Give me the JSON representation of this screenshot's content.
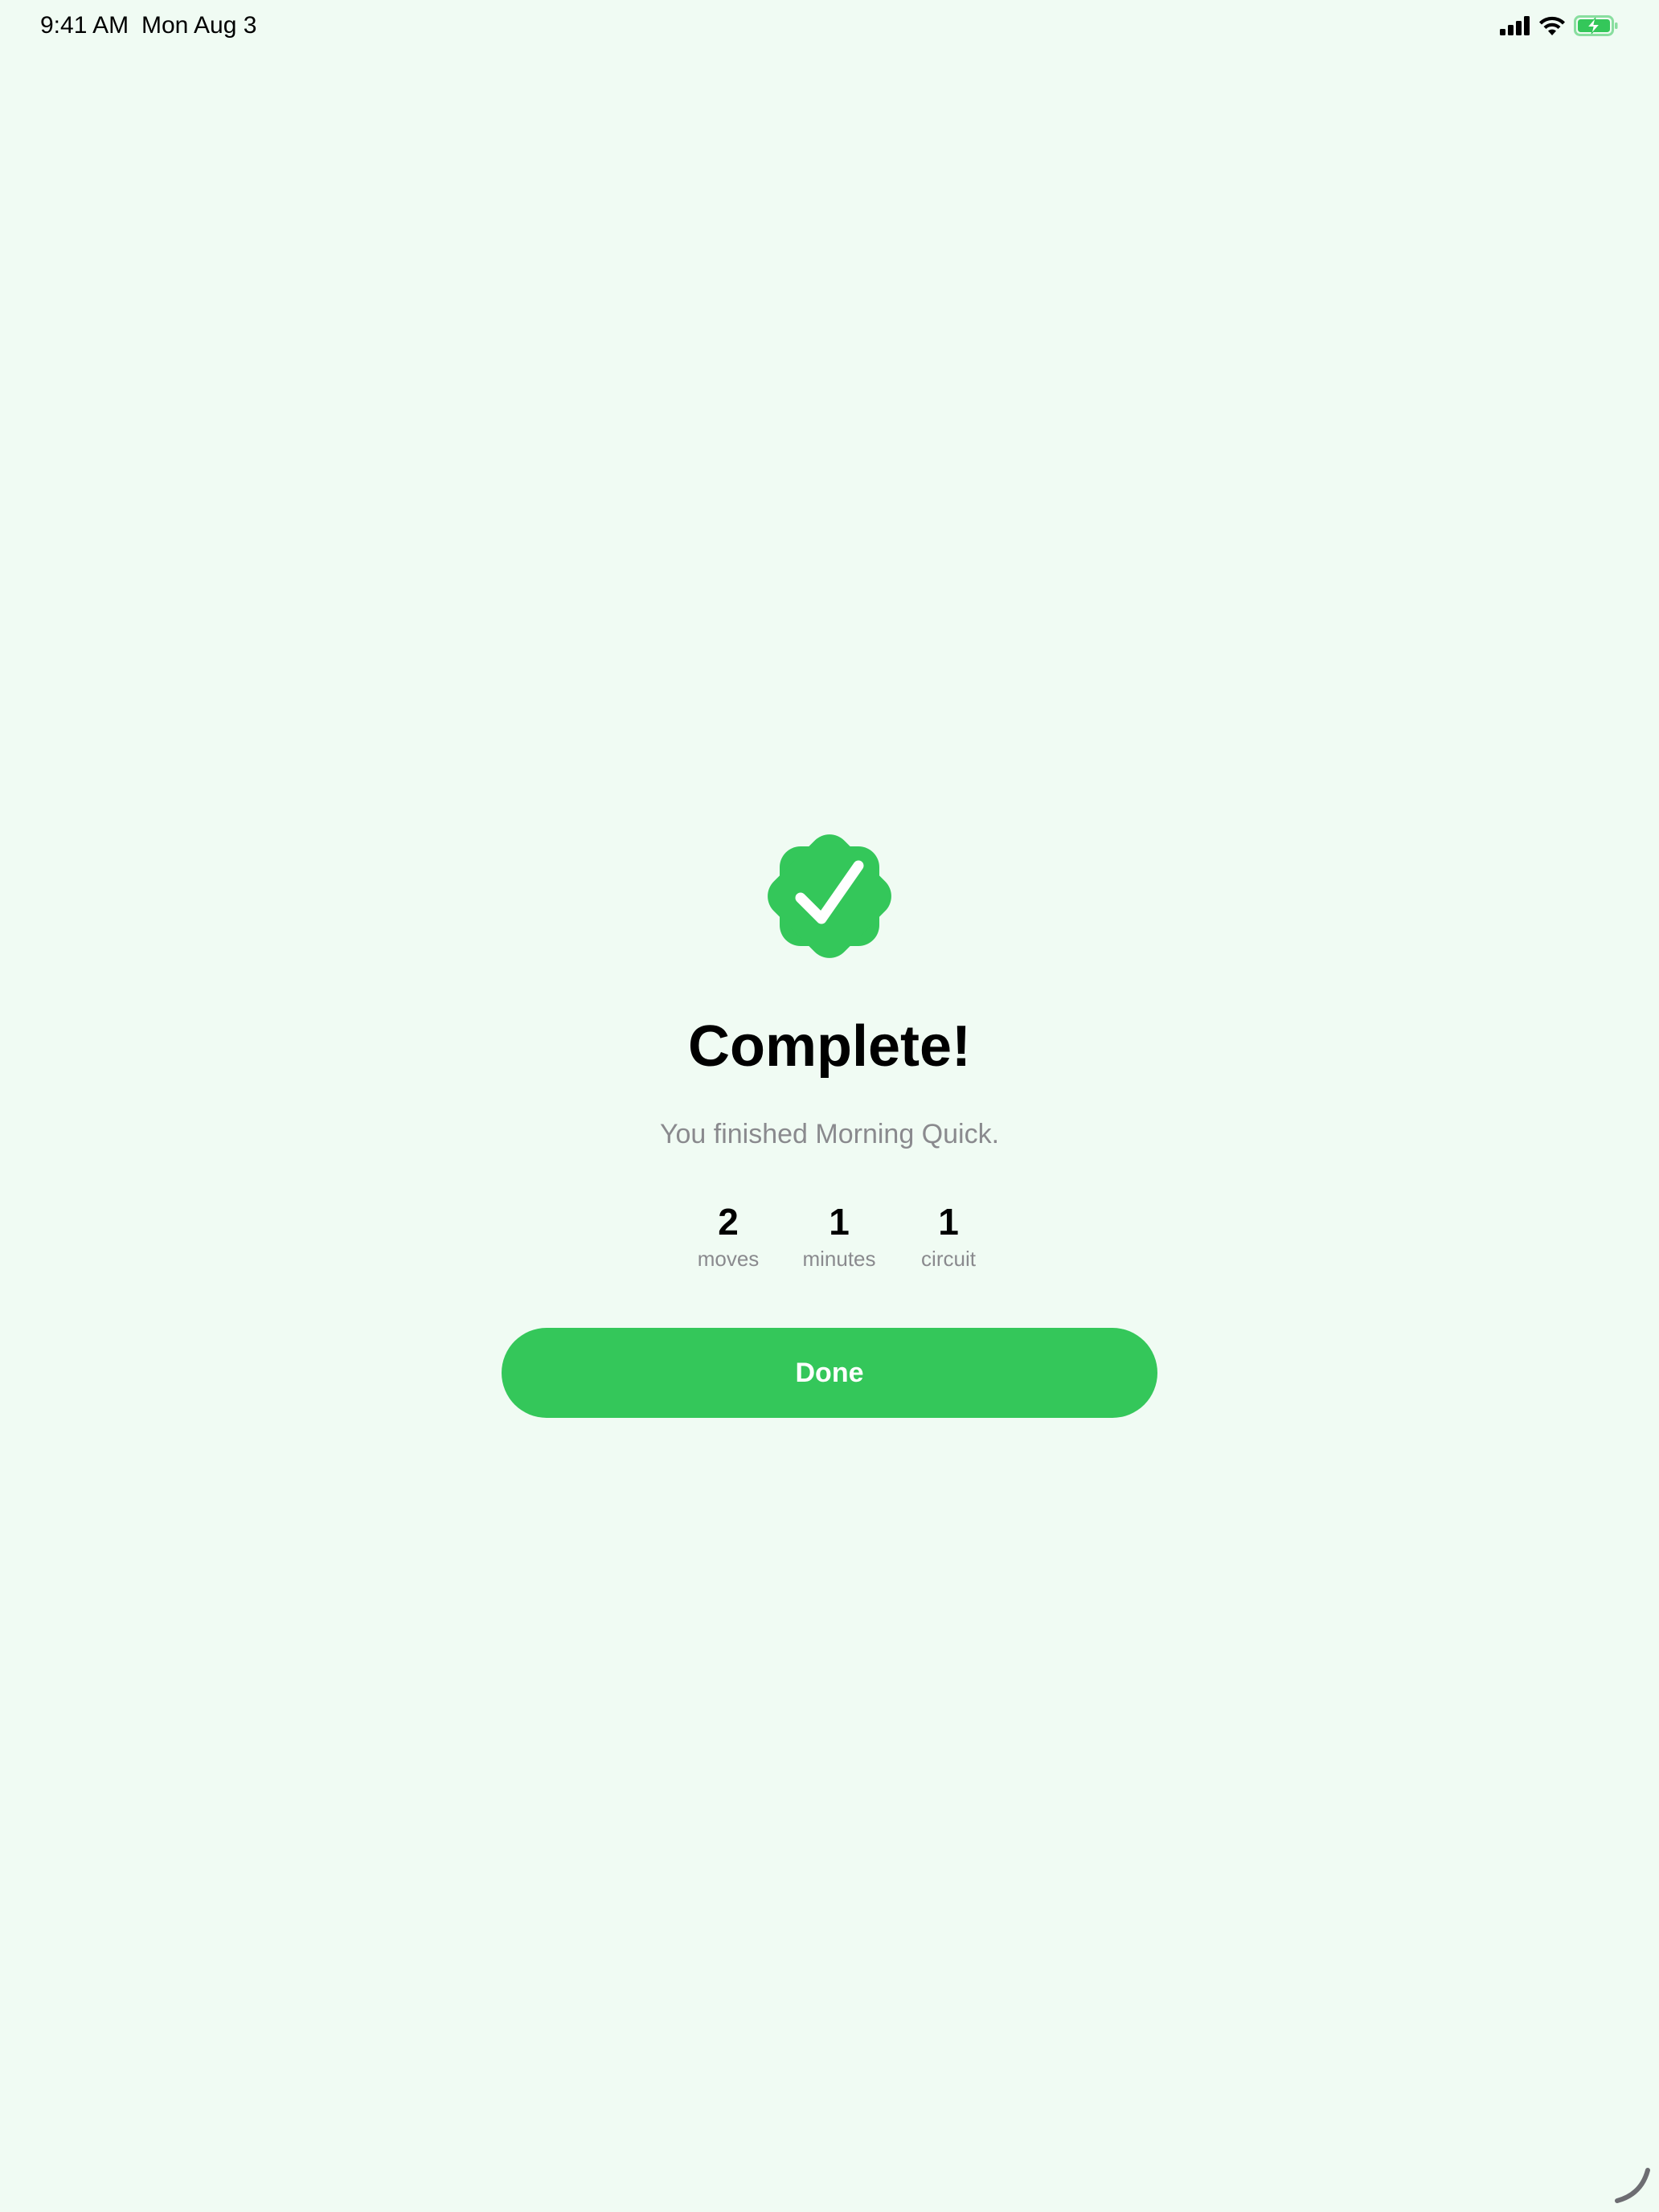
{
  "status_bar": {
    "time": "9:41 AM",
    "date": "Mon Aug 3",
    "icons": [
      "cellular-signal-icon",
      "wifi-icon",
      "battery-charging-icon"
    ]
  },
  "completion": {
    "badge_icon": "checkmark-seal-icon",
    "title": "Complete!",
    "subtitle": "You finished Morning Quick.",
    "stats": [
      {
        "value": "2",
        "label": "moves"
      },
      {
        "value": "1",
        "label": "minutes"
      },
      {
        "value": "1",
        "label": "circuit"
      }
    ],
    "done_label": "Done"
  },
  "colors": {
    "background": "#f0fbf3",
    "accent": "#34c75a",
    "secondary_text": "#8a8a8e"
  }
}
